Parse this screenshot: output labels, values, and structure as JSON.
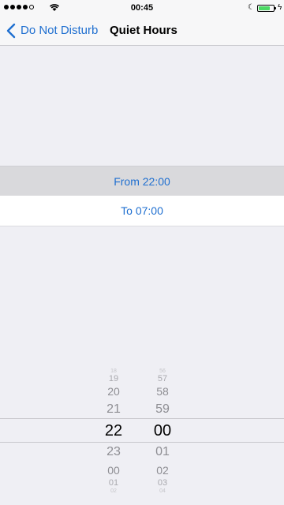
{
  "status_bar": {
    "time": "00:45",
    "battery_color": "#4cd964",
    "icons": [
      "signal-icon",
      "wifi-icon",
      "moon-icon",
      "battery-icon",
      "charging-icon"
    ]
  },
  "nav": {
    "back_label": "Do Not Disturb",
    "title": "Quiet Hours",
    "accent_color": "#1f6fd0"
  },
  "rows": {
    "from_label": "From 22:00",
    "to_label": "To 07:00"
  },
  "picker": {
    "hours": [
      "18",
      "19",
      "20",
      "21",
      "22",
      "23",
      "00",
      "01",
      "02"
    ],
    "minutes": [
      "56",
      "57",
      "58",
      "59",
      "00",
      "01",
      "02",
      "03",
      "04"
    ],
    "selected_hour": "22",
    "selected_minute": "00"
  }
}
